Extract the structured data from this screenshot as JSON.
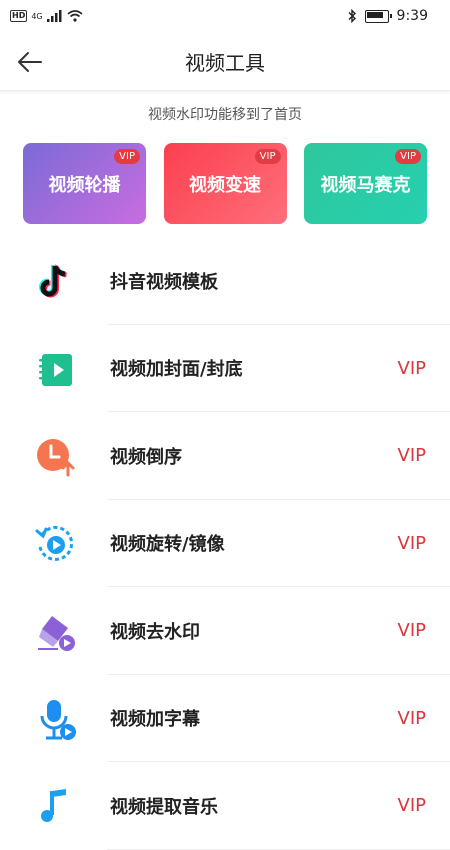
{
  "status_bar": {
    "hd": "HD",
    "net": "4G",
    "time": "9:39"
  },
  "header": {
    "title": "视频工具"
  },
  "notice": "视频水印功能移到了首页",
  "cards": [
    {
      "label": "视频轮播",
      "badge": "VIP"
    },
    {
      "label": "视频变速",
      "badge": "VIP"
    },
    {
      "label": "视频马赛克",
      "badge": "VIP"
    }
  ],
  "tools": [
    {
      "label": "抖音视频模板",
      "vip": "",
      "icon": "tiktok-icon"
    },
    {
      "label": "视频加封面/封底",
      "vip": "VIP",
      "icon": "video-book-icon"
    },
    {
      "label": "视频倒序",
      "vip": "VIP",
      "icon": "clock-reverse-icon"
    },
    {
      "label": "视频旋转/镜像",
      "vip": "VIP",
      "icon": "rotate-icon"
    },
    {
      "label": "视频去水印",
      "vip": "VIP",
      "icon": "eraser-icon"
    },
    {
      "label": "视频加字幕",
      "vip": "VIP",
      "icon": "microphone-icon"
    },
    {
      "label": "视频提取音乐",
      "vip": "VIP",
      "icon": "music-note-icon"
    }
  ],
  "colors": {
    "vip_text": "#d9363e",
    "card_1": "#9a6cdb",
    "card_2": "#fc4a58",
    "card_3": "#2bcba5"
  }
}
